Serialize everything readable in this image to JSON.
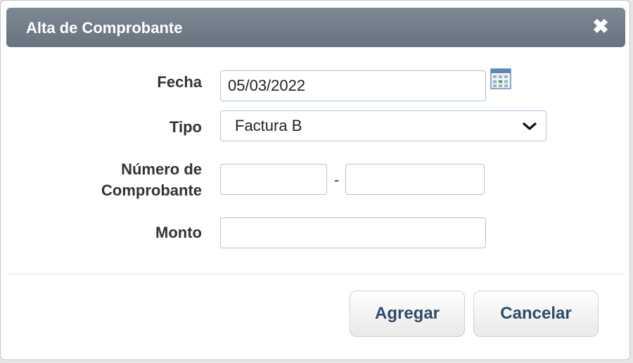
{
  "dialog": {
    "title": "Alta de Comprobante",
    "close_glyph": "✖"
  },
  "form": {
    "fecha": {
      "label": "Fecha",
      "value": "05/03/2022",
      "icon": "calendar-icon"
    },
    "tipo": {
      "label": "Tipo",
      "selected": "Factura B",
      "icon": "chevron-down-icon"
    },
    "numero": {
      "label_line1": "Número de",
      "label_line2": "Comprobante",
      "separator": "-",
      "value_1": "",
      "value_2": ""
    },
    "monto": {
      "label": "Monto",
      "value": ""
    }
  },
  "buttons": {
    "agregar": "Agregar",
    "cancelar": "Cancelar"
  },
  "colors": {
    "titlebar": "#6f7b87",
    "field_border": "#a9c2de",
    "button_text": "#2f4a6b"
  }
}
